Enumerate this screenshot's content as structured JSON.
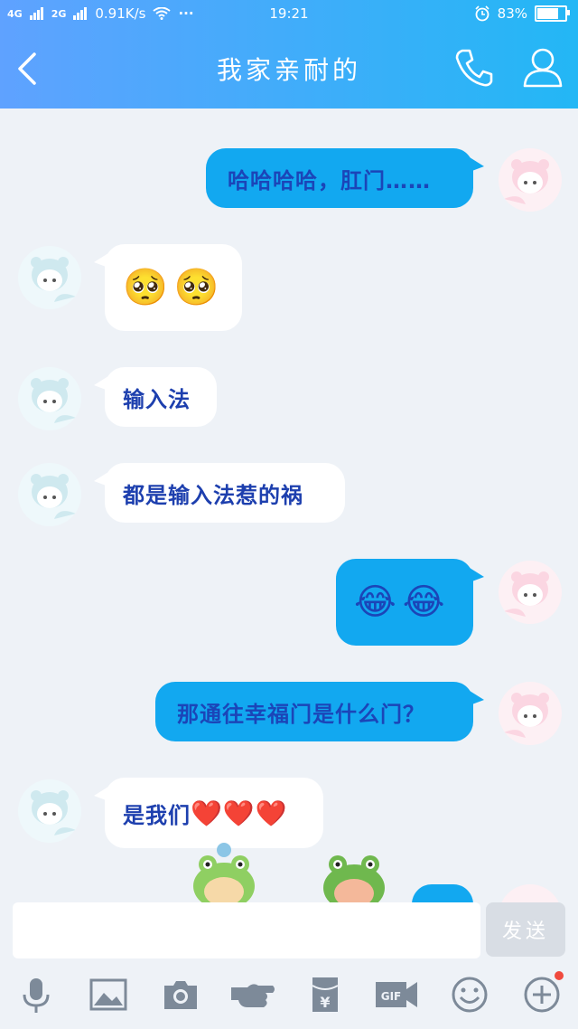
{
  "status": {
    "network": "4G",
    "network2": "2G",
    "speed": "0.91K/s",
    "dots": "···",
    "time": "19:21",
    "battery": "83%",
    "battery_level": 0.83
  },
  "header": {
    "title": "我家亲耐的"
  },
  "messages": [
    {
      "side": "out",
      "text": "哈哈哈哈，肛门……"
    },
    {
      "side": "in",
      "emojis": [
        "🥺",
        "🥺"
      ]
    },
    {
      "side": "in",
      "text": "输入法"
    },
    {
      "side": "in",
      "text": "都是输入法惹的祸"
    },
    {
      "side": "out",
      "emojis": [
        "😂",
        "😂"
      ]
    },
    {
      "side": "out",
      "text": "那通往幸福门是什么门？"
    },
    {
      "side": "in",
      "text": "是我们",
      "hearts": [
        "❤️",
        "❤️",
        "❤️"
      ]
    }
  ],
  "input": {
    "placeholder": "",
    "send_label": "发送"
  },
  "toolbar": [
    "microphone-icon",
    "image-icon",
    "camera-icon",
    "poke-icon",
    "red-packet-icon",
    "gif-icon",
    "emoji-icon",
    "plus-icon"
  ],
  "colors": {
    "header_start": "#5fa2ff",
    "header_end": "#23b7f5",
    "out_bubble": "#12a8f0",
    "in_bubble": "#ffffff",
    "text_blue": "#1d3fae"
  }
}
